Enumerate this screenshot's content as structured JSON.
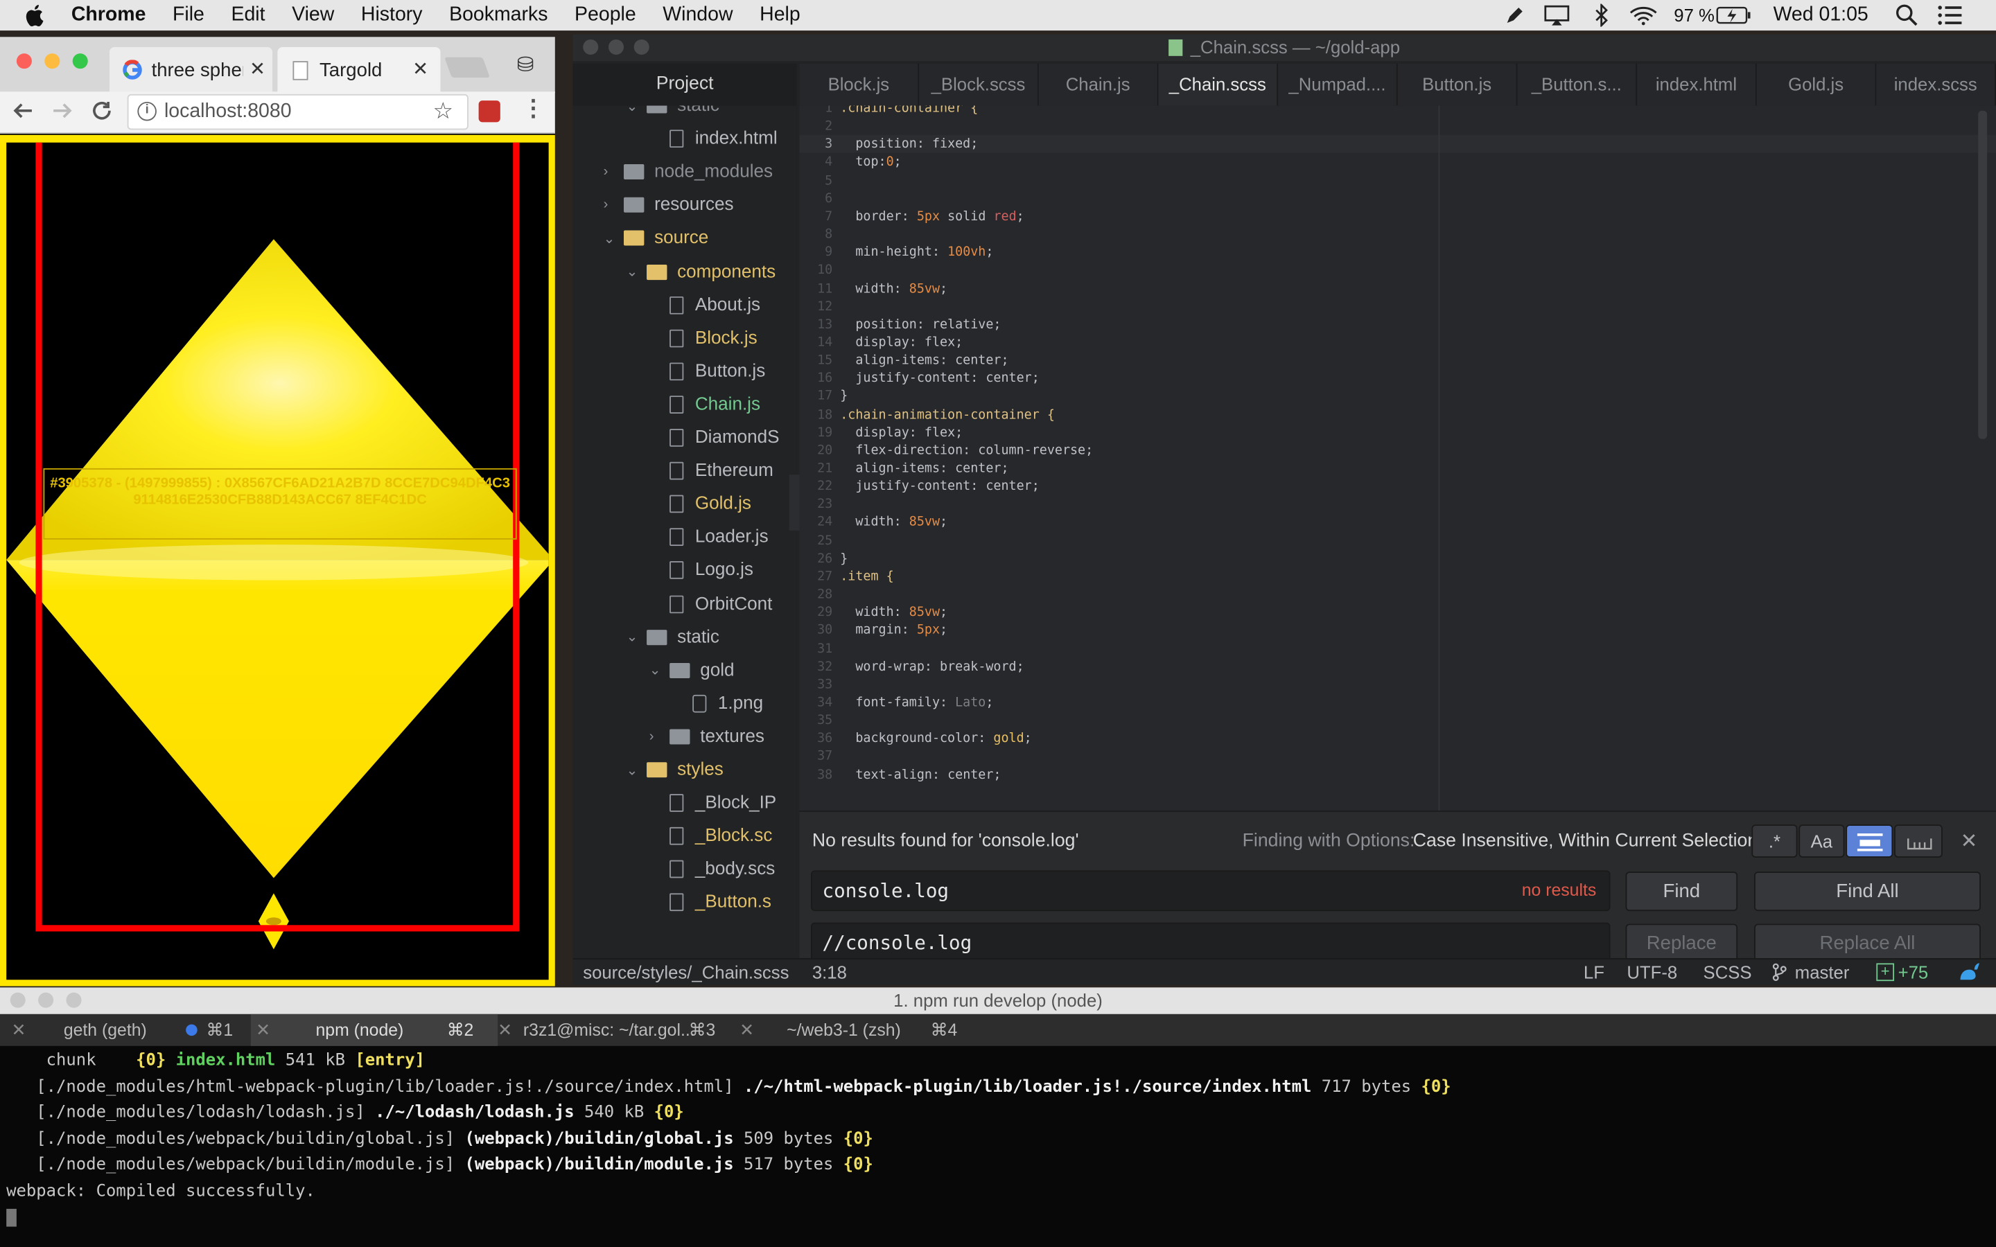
{
  "menubar": {
    "app": "Chrome",
    "menus": [
      "File",
      "Edit",
      "View",
      "History",
      "Bookmarks",
      "People",
      "Window",
      "Help"
    ],
    "battery": "97 %",
    "clock": "Wed 01:05"
  },
  "browser": {
    "tabs": [
      {
        "title": "three spher"
      },
      {
        "title": "Targold"
      }
    ],
    "url": "localhost:8080",
    "page_text": "#3905378 - (1497999855) : 0X8567CF6AD21A2B7D 8CCE7DC94DF4C39114816E2530CFB88D143ACC67 8EF4C1DC",
    "colors": {
      "gold": "#ffe600",
      "border": "#ff0000"
    }
  },
  "atom": {
    "title": "_Chain.scss — ~/gold-app",
    "project_label": "Project",
    "tree": [
      {
        "label": "static",
        "type": "folder",
        "depth": 1,
        "open": true,
        "color": "#8a8d92"
      },
      {
        "label": "index.html",
        "type": "file",
        "depth": 2,
        "color": "#b9bbbe"
      },
      {
        "label": "node_modules",
        "type": "folder",
        "depth": 0,
        "open": false,
        "color": "#8a8d92"
      },
      {
        "label": "resources",
        "type": "folder",
        "depth": 0,
        "open": false,
        "color": "#b9bbbe"
      },
      {
        "label": "source",
        "type": "folder",
        "depth": 0,
        "open": true,
        "color": "#e2c16a",
        "dot": true
      },
      {
        "label": "components",
        "type": "folder",
        "depth": 1,
        "open": true,
        "color": "#e2c16a",
        "dot": true
      },
      {
        "label": "About.js",
        "type": "file",
        "depth": 2,
        "color": "#b9bbbe"
      },
      {
        "label": "Block.js",
        "type": "file",
        "depth": 2,
        "color": "#e2c16a",
        "dot": true
      },
      {
        "label": "Button.js",
        "type": "file",
        "depth": 2,
        "color": "#b9bbbe"
      },
      {
        "label": "Chain.js",
        "type": "file",
        "depth": 2,
        "color": "#73c990",
        "dot": true,
        "green": true
      },
      {
        "label": "DiamondS",
        "type": "file",
        "depth": 2,
        "color": "#b9bbbe"
      },
      {
        "label": "Ethereum",
        "type": "file",
        "depth": 2,
        "color": "#b9bbbe"
      },
      {
        "label": "Gold.js",
        "type": "file",
        "depth": 2,
        "color": "#e2c16a",
        "dot": true
      },
      {
        "label": "Loader.js",
        "type": "file",
        "depth": 2,
        "color": "#b9bbbe"
      },
      {
        "label": "Logo.js",
        "type": "file",
        "depth": 2,
        "color": "#b9bbbe"
      },
      {
        "label": "OrbitCont",
        "type": "file",
        "depth": 2,
        "color": "#b9bbbe"
      },
      {
        "label": "static",
        "type": "folder",
        "depth": 1,
        "open": true,
        "color": "#b9bbbe"
      },
      {
        "label": "gold",
        "type": "folder",
        "depth": 2,
        "open": true,
        "color": "#b9bbbe"
      },
      {
        "label": "1.png",
        "type": "image",
        "depth": 3,
        "color": "#b9bbbe"
      },
      {
        "label": "textures",
        "type": "folder",
        "depth": 2,
        "open": false,
        "color": "#b9bbbe"
      },
      {
        "label": "styles",
        "type": "folder",
        "depth": 1,
        "open": true,
        "color": "#e2c16a",
        "dot": true
      },
      {
        "label": "_Block_IP",
        "type": "file",
        "depth": 2,
        "color": "#b9bbbe"
      },
      {
        "label": "_Block.sc",
        "type": "file",
        "depth": 2,
        "color": "#e2c16a",
        "dot": true
      },
      {
        "label": "_body.scs",
        "type": "file",
        "depth": 2,
        "color": "#b9bbbe"
      },
      {
        "label": "_Button.s",
        "type": "file",
        "depth": 2,
        "color": "#e2c16a",
        "dot": true
      }
    ],
    "tabs": [
      "Block.js",
      "_Block.scss",
      "Chain.js",
      "_Chain.scss",
      "_Numpad....",
      "Button.js",
      "_Button.s...",
      "index.html",
      "Gold.js",
      "index.scss"
    ],
    "active_tab": 3,
    "code": [
      [
        ".chain-container {",
        "sel"
      ],
      [
        "",
        ""
      ],
      [
        "  position: fixed;",
        "kw"
      ],
      [
        "  top:0;",
        "kw"
      ],
      [
        "",
        ""
      ],
      [
        "",
        ""
      ],
      [
        "  border: 5px solid red;",
        "kw"
      ],
      [
        "",
        ""
      ],
      [
        "  min-height: 100vh;",
        "kw"
      ],
      [
        "",
        ""
      ],
      [
        "  width: 85vw;",
        "kw"
      ],
      [
        "",
        ""
      ],
      [
        "  position: relative;",
        "kw"
      ],
      [
        "  display: flex;",
        "kw"
      ],
      [
        "  align-items: center;",
        "kw"
      ],
      [
        "  justify-content: center;",
        "kw"
      ],
      [
        "}",
        "kw"
      ],
      [
        ".chain-animation-container {",
        "sel"
      ],
      [
        "  display: flex;",
        "kw"
      ],
      [
        "  flex-direction: column-reverse;",
        "kw"
      ],
      [
        "  align-items: center;",
        "kw"
      ],
      [
        "  justify-content: center;",
        "kw"
      ],
      [
        "",
        ""
      ],
      [
        "  width: 85vw;",
        "kw"
      ],
      [
        "",
        ""
      ],
      [
        "}",
        "kw"
      ],
      [
        ".item {",
        "sel"
      ],
      [
        "",
        ""
      ],
      [
        "  width: 85vw;",
        "kw"
      ],
      [
        "  margin: 5px;",
        "kw"
      ],
      [
        "",
        ""
      ],
      [
        "  word-wrap: break-word;",
        "kw"
      ],
      [
        "",
        ""
      ],
      [
        "  font-family: Lato;",
        "kw"
      ],
      [
        "",
        ""
      ],
      [
        "  background-color: gold;",
        "kw"
      ],
      [
        "",
        ""
      ],
      [
        "  text-align: center;",
        "kw"
      ]
    ],
    "find": {
      "message": "No results found for 'console.log'",
      "options_label": "Finding with Options:",
      "options_value": "Case Insensitive, Within Current Selection",
      "regex_label": ".*",
      "case_label": "Aa",
      "find_value": "console.log",
      "no_results": "no results",
      "replace_value": "//console.log",
      "find_btn": "Find",
      "find_all_btn": "Find All",
      "replace_btn": "Replace",
      "replace_all_btn": "Replace All"
    },
    "status": {
      "path": "source/styles/_Chain.scss",
      "cursor": "3:18",
      "eol": "LF",
      "encoding": "UTF-8",
      "grammar": "SCSS",
      "branch": "master",
      "changes": "+75"
    }
  },
  "terminal": {
    "title": "1. npm run develop (node)",
    "tabs": [
      {
        "label": "geth (geth)",
        "key": "⌘1"
      },
      {
        "label": "npm (node)",
        "key": "⌘2"
      },
      {
        "label": "r3z1@misc: ~/tar.gol...",
        "key": "⌘3"
      },
      {
        "label": "~/web3-1 (zsh)",
        "key": "⌘4"
      }
    ],
    "lines": [
      {
        "a": "    chunk    ",
        "b": "{0}",
        "c": " index.html ",
        "d": "541 kB",
        "e": " [entry]"
      },
      {
        "a": "   [./node_modules/html-webpack-plugin/lib/loader.js!./source/index.html] ",
        "b2": "./~/html-webpack-plugin/lib/loader.js!./source/index.html",
        "d": " 717 bytes ",
        "y": "{0}"
      },
      {
        "a": "   [./node_modules/lodash/lodash.js] ",
        "b2": "./~/lodash/lodash.js",
        "d": " 540 kB ",
        "y": "{0}"
      },
      {
        "a": "   [./node_modules/webpack/buildin/global.js] ",
        "b2": "(webpack)/buildin/global.js",
        "d": " 509 bytes ",
        "y": "{0}"
      },
      {
        "a": "   [./node_modules/webpack/buildin/module.js] ",
        "b2": "(webpack)/buildin/module.js",
        "d": " 517 bytes ",
        "y": "{0}"
      },
      {
        "a": "webpack: Compiled successfully."
      }
    ]
  }
}
